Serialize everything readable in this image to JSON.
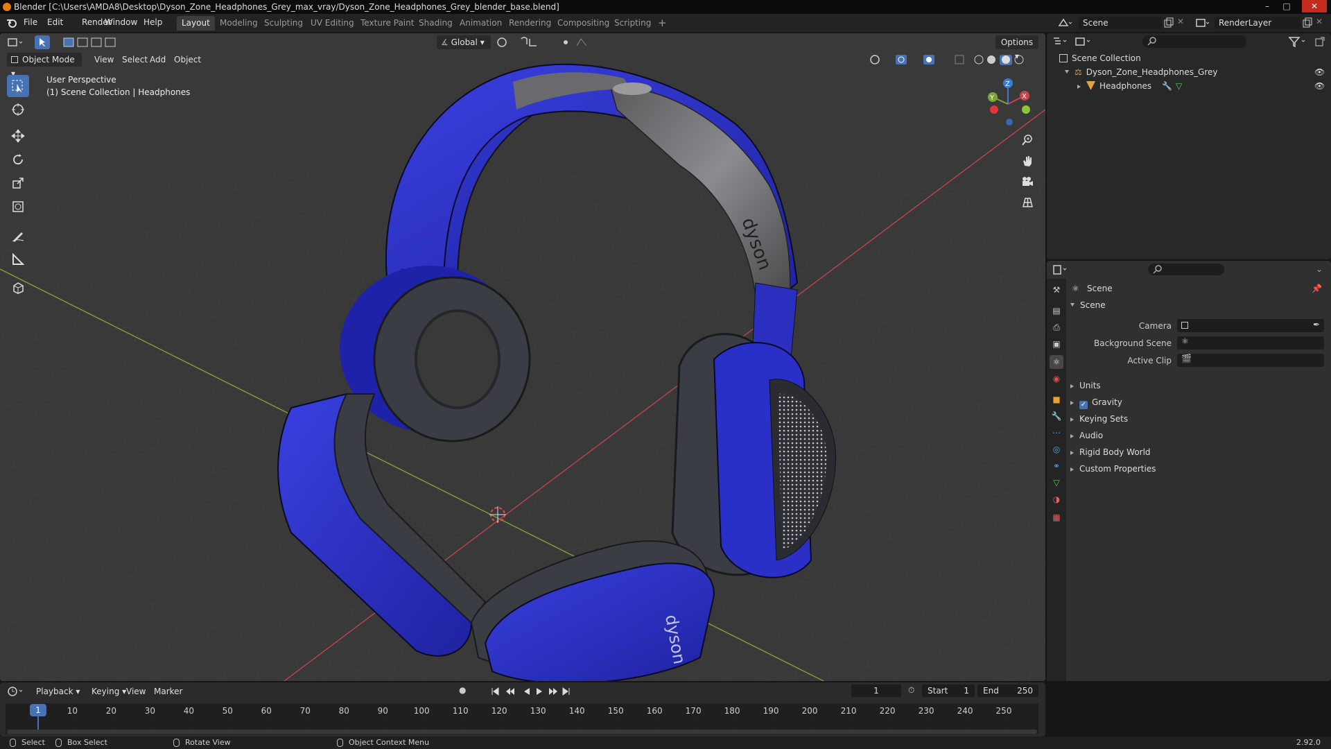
{
  "window": {
    "title": "Blender [C:\\Users\\AMDA8\\Desktop\\Dyson_Zone_Headphones_Grey_max_vray/Dyson_Zone_Headphones_Grey_blender_base.blend]"
  },
  "menus": [
    "File",
    "Edit",
    "Render",
    "Window",
    "Help"
  ],
  "workspaces": [
    "Layout",
    "Modeling",
    "Sculpting",
    "UV Editing",
    "Texture Paint",
    "Shading",
    "Animation",
    "Rendering",
    "Compositing",
    "Scripting"
  ],
  "active_workspace": "Layout",
  "scene_field": "Scene",
  "view_layer_field": "RenderLayer",
  "viewport": {
    "mode": "Object Mode",
    "menus": [
      "View",
      "Select",
      "Add",
      "Object"
    ],
    "transform_orientation": "Global",
    "options_label": "Options",
    "overlay_title": "User Perspective",
    "overlay_subtitle": "(1) Scene Collection | Headphones",
    "gizmo_axes": {
      "x": "X",
      "y": "Y",
      "z": "Z"
    },
    "tools": [
      "select-box",
      "cursor",
      "move",
      "rotate",
      "scale",
      "transform",
      "annotate",
      "measure",
      "add-cube"
    ],
    "model_brand_text": "dyson",
    "colors": {
      "background": "#393939",
      "headphone_blue": "#2b32c8",
      "cushion_grey": "#3e4148",
      "x_axis": "#c8454f",
      "y_axis": "#7fa33a",
      "active_tool": "#4772b3"
    }
  },
  "outliner": {
    "root": "Scene Collection",
    "items": [
      {
        "label": "Dyson_Zone_Headphones_Grey",
        "level": 1
      },
      {
        "label": "Headphones",
        "level": 2
      }
    ]
  },
  "properties": {
    "context": "Scene",
    "panel_title": "Scene",
    "fields": [
      {
        "label": "Camera",
        "value": ""
      },
      {
        "label": "Background Scene",
        "value": ""
      },
      {
        "label": "Active Clip",
        "value": ""
      }
    ],
    "subpanels": [
      "Units",
      "Gravity",
      "Keying Sets",
      "Audio",
      "Rigid Body World",
      "Custom Properties"
    ],
    "gravity_checked": true
  },
  "timeline": {
    "menus": [
      "Playback",
      "Keying",
      "View",
      "Marker"
    ],
    "current_frame": "1",
    "start_label": "Start",
    "start": "1",
    "end_label": "End",
    "end": "250",
    "ruler": [
      "1",
      "10",
      "20",
      "30",
      "40",
      "50",
      "60",
      "70",
      "80",
      "90",
      "100",
      "110",
      "120",
      "130",
      "140",
      "150",
      "160",
      "170",
      "180",
      "190",
      "200",
      "210",
      "220",
      "230",
      "240",
      "250"
    ]
  },
  "statusbar": {
    "items": [
      "Select",
      "Box Select",
      "Rotate View",
      "Object Context Menu"
    ],
    "version": "2.92.0"
  }
}
